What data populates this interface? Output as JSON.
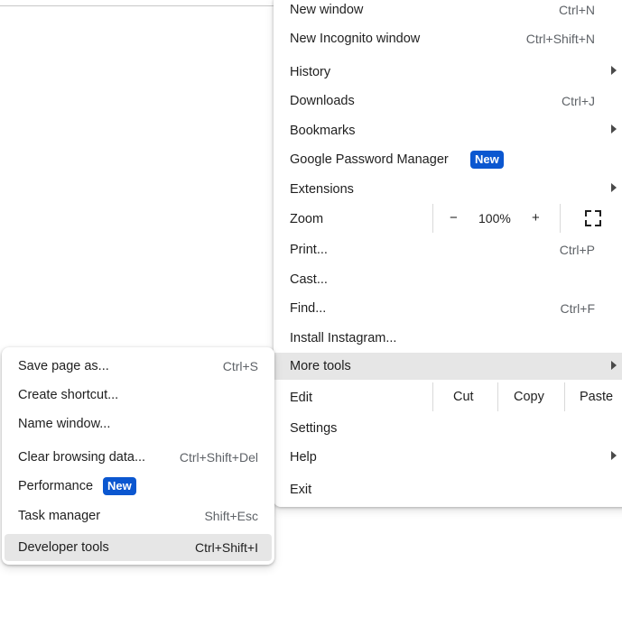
{
  "menu": {
    "new_window": {
      "label": "New window",
      "shortcut": "Ctrl+N"
    },
    "new_incognito": {
      "label": "New Incognito window",
      "shortcut": "Ctrl+Shift+N"
    },
    "history": {
      "label": "History"
    },
    "downloads": {
      "label": "Downloads",
      "shortcut": "Ctrl+J"
    },
    "bookmarks": {
      "label": "Bookmarks"
    },
    "password_manager": {
      "label": "Google Password Manager",
      "badge": "New"
    },
    "extensions": {
      "label": "Extensions"
    },
    "zoom": {
      "label": "Zoom",
      "minus": "−",
      "value": "100%",
      "plus": "+"
    },
    "print": {
      "label": "Print...",
      "shortcut": "Ctrl+P"
    },
    "cast": {
      "label": "Cast..."
    },
    "find": {
      "label": "Find...",
      "shortcut": "Ctrl+F"
    },
    "install": {
      "label": "Install Instagram..."
    },
    "more_tools": {
      "label": "More tools"
    },
    "edit": {
      "label": "Edit",
      "cut": "Cut",
      "copy": "Copy",
      "paste": "Paste"
    },
    "settings": {
      "label": "Settings"
    },
    "help": {
      "label": "Help"
    },
    "exit": {
      "label": "Exit"
    }
  },
  "submenu": {
    "save_page": {
      "label": "Save page as...",
      "shortcut": "Ctrl+S"
    },
    "create_shortcut": {
      "label": "Create shortcut..."
    },
    "name_window": {
      "label": "Name window..."
    },
    "clear_browsing": {
      "label": "Clear browsing data...",
      "shortcut": "Ctrl+Shift+Del"
    },
    "performance": {
      "label": "Performance",
      "badge": "New"
    },
    "task_manager": {
      "label": "Task manager",
      "shortcut": "Shift+Esc"
    },
    "developer_tools": {
      "label": "Developer tools",
      "shortcut": "Ctrl+Shift+I"
    }
  },
  "colors": {
    "badge": "#0b57d0",
    "highlight": "#e6e6e6"
  }
}
